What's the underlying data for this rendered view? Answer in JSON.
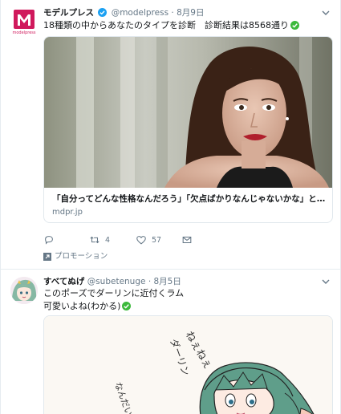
{
  "tweets": [
    {
      "name": "モデルプレス",
      "handle": "@modelpress",
      "dot": "·",
      "time": "8月9日",
      "avatar_text": "modelpress",
      "text": "18種類の中からあなたのタイプを診断　診断結果は8568通り",
      "card": {
        "title": "「自分ってどんな性格なんだろう」「欠点ばかりなんじゃないかな」と…",
        "domain": "mdpr.jp"
      },
      "actions": {
        "retweets": "4",
        "likes": "57"
      },
      "promoted": "プロモーション"
    },
    {
      "name": "すべてぬげ",
      "handle": "@subetenuge",
      "dot": "·",
      "time": "8月5日",
      "text_line1": "このポーズでダーリンに近付くラム",
      "text_line2": "可愛いよね(わかる)",
      "art_text": [
        "ねぇねぇ",
        "ダーリン",
        "なんだい"
      ]
    }
  ],
  "colors": {
    "brand_magenta": "#d0195c",
    "verified_blue": "#1da1f2",
    "emoji_green": "#3cb93c",
    "secondary_text": "#657786"
  },
  "icons": [
    "chevron-down-icon",
    "reply-icon",
    "retweet-icon",
    "like-icon",
    "dm-icon",
    "promoted-icon",
    "verified-icon",
    "check-emoji-icon"
  ]
}
